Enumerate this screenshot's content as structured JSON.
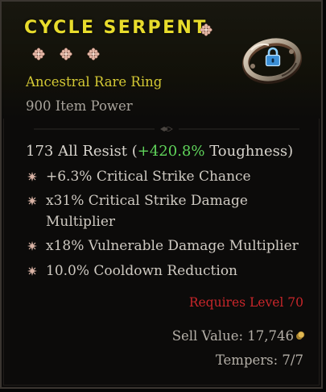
{
  "item": {
    "name": "CYCLE SERPENT",
    "type": "Ancestral Rare Ring",
    "power": "900 Item Power",
    "main_stat": {
      "value": "173 All Resist",
      "open_paren": "(",
      "toughness_value": "+420.8%",
      "toughness_label": "Toughness",
      "close_paren": ")"
    },
    "affixes": [
      "+6.3% Critical Strike Chance",
      "x31% Critical Strike Damage Multiplier",
      "x18% Vulnerable Damage Multiplier",
      "10.0% Cooldown Reduction"
    ],
    "requires": "Requires Level 70",
    "sell_value": "Sell Value: 17,746",
    "tempers": "Tempers: 7/7",
    "locked": true,
    "icons": {
      "ancestral_flower": "flower-icon",
      "affix_bullet": "star-bullet-icon",
      "gold": "gold-coin-icon",
      "lock": "lock-icon",
      "ring": "ring-icon"
    },
    "colors": {
      "title": "#e8dc2c",
      "rarity": "#d4c934",
      "toughness": "#5fd35a",
      "requirement": "#c8262a",
      "lock": "#4aa3e0"
    }
  }
}
